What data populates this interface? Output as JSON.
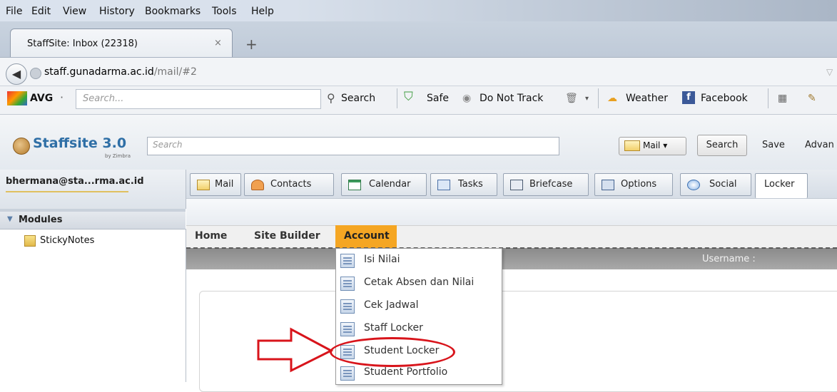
{
  "browser": {
    "menu": [
      "File",
      "Edit",
      "View",
      "History",
      "Bookmarks",
      "Tools",
      "Help"
    ],
    "tab_title": "StaffSite: Inbox (22318)",
    "tab_close": "×",
    "new_tab": "+",
    "url_host": "staff.gunadarma.ac.id",
    "url_path": "/mail/#2"
  },
  "avg_toolbar": {
    "logo": "AVG",
    "dropdown": "·",
    "search_placeholder": "Search...",
    "search_button": "Search",
    "safe": "Safe",
    "do_not_track": "Do Not Track",
    "weather": "Weather",
    "facebook": "Facebook"
  },
  "zimbra": {
    "logo": "Staffsite 3.0",
    "logo_sub": "by Zimbra",
    "search_placeholder": "Search",
    "mail_select": "Mail ▾",
    "search_button": "Search",
    "save": "Save",
    "advanced": "Advan",
    "user": "bhermana@sta...rma.ac.id",
    "modules_label": "Modules",
    "sticky_notes": "StickyNotes",
    "app_tabs": [
      "Mail",
      "Contacts",
      "Calendar",
      "Tasks",
      "Briefcase",
      "Options",
      "Social",
      "Locker"
    ]
  },
  "locker": {
    "nav": [
      "Home",
      "Site Builder",
      "Account"
    ],
    "username_label": "Username :",
    "dropdown": [
      "Isi Nilai",
      "Cetak Absen dan Nilai",
      "Cek Jadwal",
      "Staff Locker",
      "Student Locker",
      "Student Portfolio"
    ]
  },
  "colors": {
    "accent_orange": "#f5a623",
    "annotation_red": "#d8141b",
    "zimbra_blue": "#2f6fa6"
  }
}
